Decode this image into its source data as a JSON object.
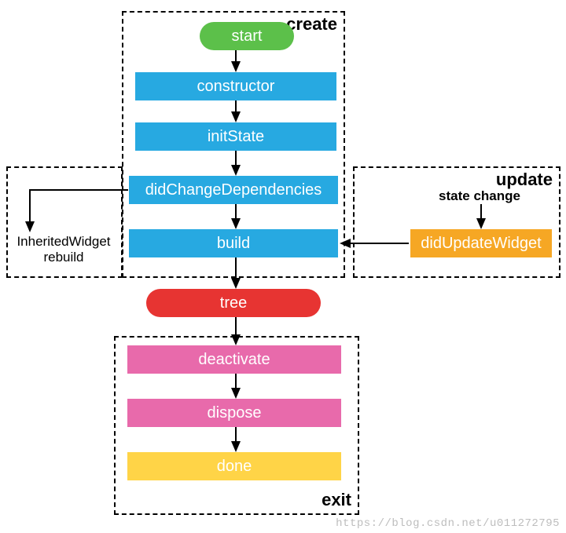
{
  "sections": {
    "create": "create",
    "update": "update",
    "exit": "exit"
  },
  "nodes": {
    "start": "start",
    "constructor": "constructor",
    "initState": "initState",
    "didChangeDeps": "didChangeDependencies",
    "build": "build",
    "tree": "tree",
    "deactivate": "deactivate",
    "dispose": "dispose",
    "done": "done",
    "didUpdate": "didUpdateWidget"
  },
  "labels": {
    "inherited_l1": "InheritedWidget",
    "inherited_l2": "rebuild",
    "state_change": "state change"
  },
  "watermark": "https://blog.csdn.net/u011272795"
}
